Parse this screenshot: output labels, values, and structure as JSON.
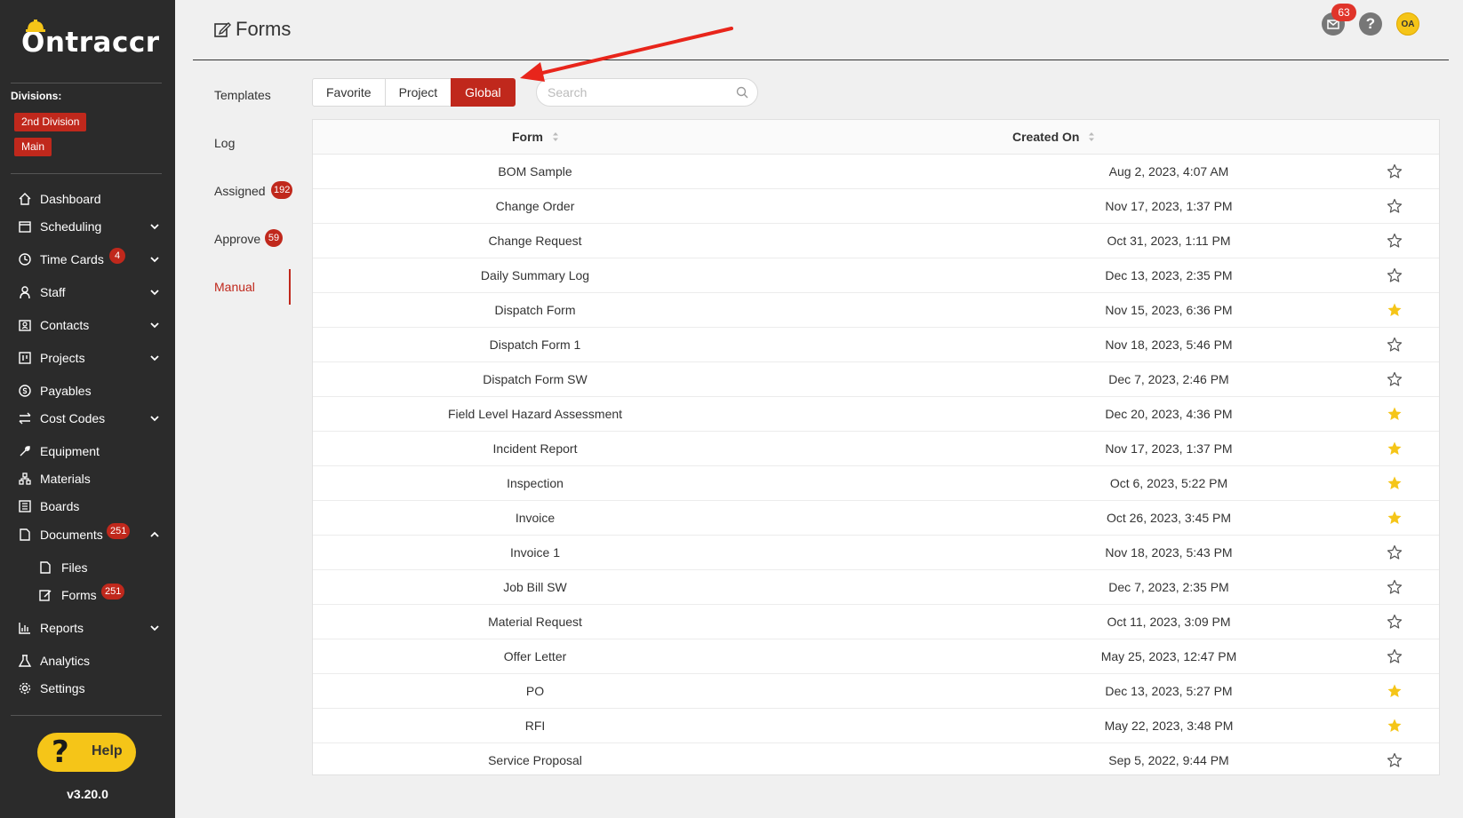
{
  "app": {
    "name": "Ontraccr",
    "version": "v3.20.0"
  },
  "sidebar": {
    "divisions_label": "Divisions:",
    "divisions": [
      "2nd Division",
      "Main"
    ],
    "items": [
      {
        "label": "Dashboard",
        "icon": "home-icon"
      },
      {
        "label": "Scheduling",
        "icon": "calendar-icon",
        "expand": true
      },
      {
        "label": "Time Cards",
        "icon": "clock-icon",
        "badge": "4",
        "expand": true
      },
      {
        "label": "Staff",
        "icon": "user-icon",
        "expand": true
      },
      {
        "label": "Contacts",
        "icon": "contacts-icon",
        "expand": true
      },
      {
        "label": "Projects",
        "icon": "project-icon",
        "expand": true
      },
      {
        "label": "Payables",
        "icon": "dollar-icon"
      },
      {
        "label": "Cost Codes",
        "icon": "swap-icon",
        "expand": true
      },
      {
        "label": "Equipment",
        "icon": "wrench-icon"
      },
      {
        "label": "Materials",
        "icon": "materials-icon"
      },
      {
        "label": "Boards",
        "icon": "board-icon"
      },
      {
        "label": "Documents",
        "icon": "document-icon",
        "badge": "251",
        "collapse": true
      },
      {
        "label": "Files",
        "icon": "file-icon",
        "sub": true
      },
      {
        "label": "Forms",
        "icon": "form-icon",
        "badge": "251",
        "sub": true
      },
      {
        "label": "Reports",
        "icon": "chart-icon",
        "expand": true
      },
      {
        "label": "Analytics",
        "icon": "flask-icon"
      },
      {
        "label": "Settings",
        "icon": "gear-icon"
      }
    ],
    "help_label": "Help"
  },
  "header": {
    "title": "Forms",
    "mail_badge": "63",
    "help_symbol": "?",
    "avatar_initials": "OA"
  },
  "left_tabs": [
    {
      "label": "Templates"
    },
    {
      "label": "Log"
    },
    {
      "label": "Assigned",
      "badge": "192"
    },
    {
      "label": "Approve",
      "badge": "59"
    },
    {
      "label": "Manual",
      "active": true
    }
  ],
  "filters": {
    "buttons": [
      "Favorite",
      "Project",
      "Global"
    ],
    "active": "Global",
    "search_placeholder": "Search",
    "search_value": ""
  },
  "table": {
    "columns": [
      "Form",
      "Created On"
    ],
    "rows": [
      {
        "form": "BOM Sample",
        "created": "Aug 2, 2023, 4:07 AM",
        "favorite": false
      },
      {
        "form": "Change Order",
        "created": "Nov 17, 2023, 1:37 PM",
        "favorite": false
      },
      {
        "form": "Change Request",
        "created": "Oct 31, 2023, 1:11 PM",
        "favorite": false
      },
      {
        "form": "Daily Summary Log",
        "created": "Dec 13, 2023, 2:35 PM",
        "favorite": false
      },
      {
        "form": "Dispatch Form",
        "created": "Nov 15, 2023, 6:36 PM",
        "favorite": true
      },
      {
        "form": "Dispatch Form 1",
        "created": "Nov 18, 2023, 5:46 PM",
        "favorite": false
      },
      {
        "form": "Dispatch Form SW",
        "created": "Dec 7, 2023, 2:46 PM",
        "favorite": false
      },
      {
        "form": "Field Level Hazard Assessment",
        "created": "Dec 20, 2023, 4:36 PM",
        "favorite": true
      },
      {
        "form": "Incident Report",
        "created": "Nov 17, 2023, 1:37 PM",
        "favorite": true
      },
      {
        "form": "Inspection",
        "created": "Oct 6, 2023, 5:22 PM",
        "favorite": true
      },
      {
        "form": "Invoice",
        "created": "Oct 26, 2023, 3:45 PM",
        "favorite": true
      },
      {
        "form": "Invoice 1",
        "created": "Nov 18, 2023, 5:43 PM",
        "favorite": false
      },
      {
        "form": "Job Bill SW",
        "created": "Dec 7, 2023, 2:35 PM",
        "favorite": false
      },
      {
        "form": "Material Request",
        "created": "Oct 11, 2023, 3:09 PM",
        "favorite": false
      },
      {
        "form": "Offer Letter",
        "created": "May 25, 2023, 12:47 PM",
        "favorite": false
      },
      {
        "form": "PO",
        "created": "Dec 13, 2023, 5:27 PM",
        "favorite": true
      },
      {
        "form": "RFI",
        "created": "May 22, 2023, 3:48 PM",
        "favorite": true
      },
      {
        "form": "Service Proposal",
        "created": "Sep 5, 2022, 9:44 PM",
        "favorite": false
      }
    ]
  },
  "colors": {
    "accent": "#c0281c",
    "sidebar_bg": "#2b2b2b",
    "star_filled": "#f5c518",
    "help_yellow": "#f5c518"
  }
}
